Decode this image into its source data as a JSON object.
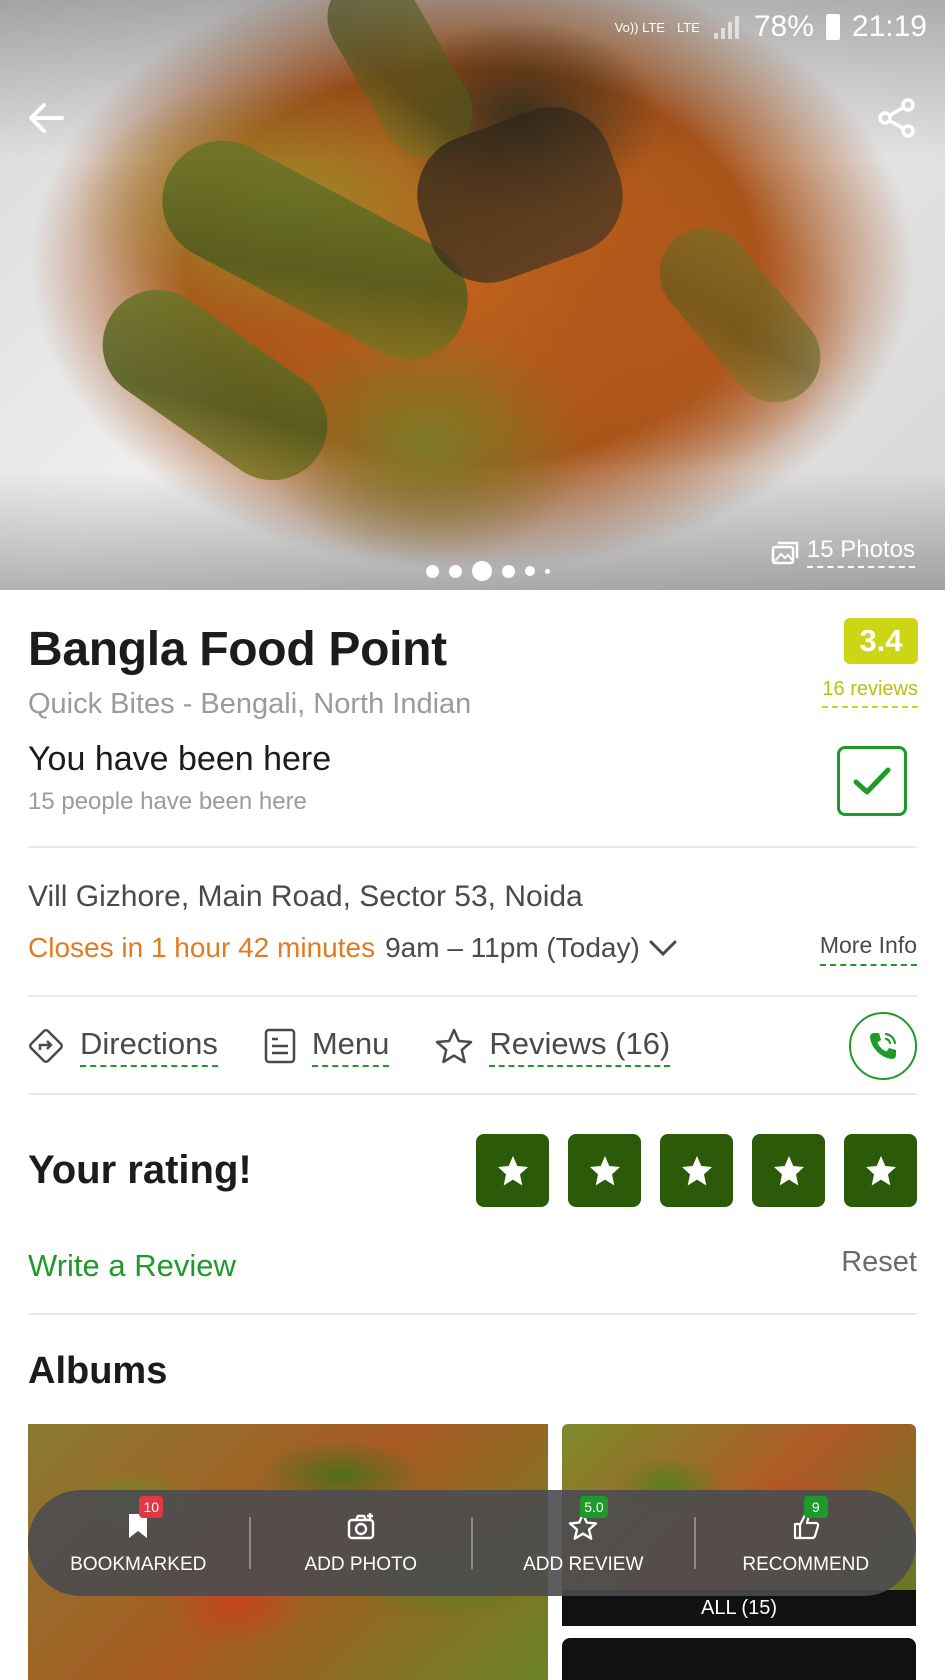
{
  "status_bar": {
    "volte": "Vo)) LTE",
    "network": "LTE",
    "battery": "78%",
    "time": "21:19"
  },
  "hero": {
    "photos_label": "15 Photos",
    "carousel_dots": 6,
    "active_dot": 3
  },
  "restaurant": {
    "name": "Bangla Food Point",
    "cuisine": "Quick Bites - Bengali, North Indian",
    "rating": "3.4",
    "rating_color": "#cdd614",
    "reviews_count": "16 reviews"
  },
  "been_here": {
    "title": "You have been here",
    "subtitle": "15 people have been here"
  },
  "location": {
    "address": "Vill Gizhore, Main Road, Sector 53, Noida",
    "closing_text": "Closes in 1 hour 42 minutes",
    "hours_text": "9am – 11pm (Today)",
    "more_info": "More Info"
  },
  "actions": {
    "directions": "Directions",
    "menu": "Menu",
    "reviews": "Reviews (16)"
  },
  "your_rating": {
    "title": "Your rating!",
    "stars_count": 5,
    "star_color": "#2b5a08",
    "write_review": "Write a Review",
    "reset": "Reset"
  },
  "albums": {
    "title": "Albums",
    "all_label": "ALL (15)"
  },
  "bottom_bar": {
    "bookmarked": {
      "label": "BOOKMARKED",
      "badge": "10"
    },
    "add_photo": {
      "label": "ADD PHOTO"
    },
    "add_review": {
      "label": "ADD REVIEW",
      "badge": "5.0"
    },
    "recommend": {
      "label": "RECOMMEND",
      "badge": "9"
    }
  },
  "colors": {
    "accent_green": "#1e9a2a",
    "closing_orange": "#e07b1f",
    "badge_red": "#e23744"
  }
}
